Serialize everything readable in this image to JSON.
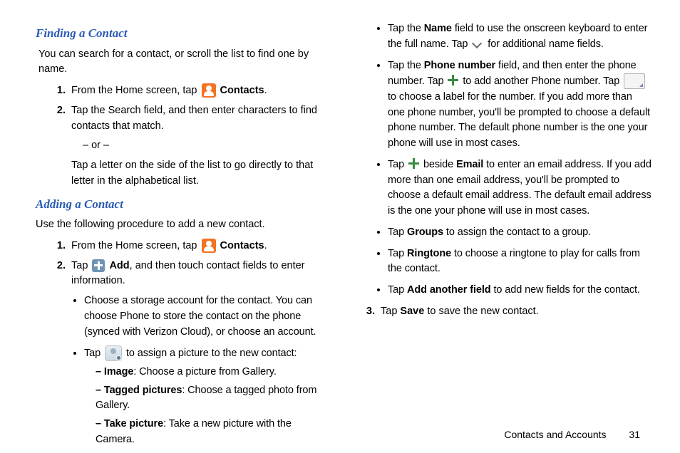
{
  "left": {
    "h1": "Finding a Contact",
    "intro1": "You can search for a contact, or scroll the list to find one by name.",
    "step1a_pre": "From the Home screen, tap ",
    "step1a_post": " Contacts",
    "step2a": "Tap the Search field, and then enter characters to find contacts that match.",
    "or": "– or –",
    "alt": "Tap a letter on the side of the list to go directly to that letter in the alphabetical list.",
    "h2": "Adding a Contact",
    "intro2": "Use the following procedure to add a new contact.",
    "step1b_pre": "From the Home screen, tap ",
    "step1b_post": " Contacts",
    "step2b_pre": "Tap ",
    "step2b_mid": " Add",
    "step2b_post": ", and then touch contact fields to enter information.",
    "b1": "Choose a storage account for the contact. You can choose Phone to store the contact on the phone (synced with Verizon Cloud), or choose an account.",
    "b2_pre": "Tap ",
    "b2_post": " to assign a picture to the new contact:",
    "d1_t": "Image",
    "d1_b": ": Choose a picture from Gallery.",
    "d2_t": "Tagged pictures",
    "d2_b": ": Choose a tagged photo from Gallery.",
    "d3_t": "Take picture",
    "d3_b": ": Take a new picture with the Camera."
  },
  "right": {
    "b1_a": "Tap the ",
    "b1_b": "Name",
    "b1_c": " field to use the onscreen keyboard to enter the full name. Tap ",
    "b1_d": " for additional name fields.",
    "b2_a": "Tap the ",
    "b2_b": "Phone number",
    "b2_c": " field, and then enter the phone number. Tap ",
    "b2_d": " to add another Phone number. Tap ",
    "b2_e": " to choose a label for the number. If you add more than one phone number, you'll be prompted to choose a default phone number. The default phone number is the one your phone will use in most cases.",
    "b3_a": "Tap ",
    "b3_b": " beside ",
    "b3_c": "Email",
    "b3_d": " to enter an email address. If you add more than one email address, you'll be prompted to choose a default email address. The default email address is the one your phone will use in most cases.",
    "b4_a": "Tap ",
    "b4_b": "Groups",
    "b4_c": " to assign the contact to a group.",
    "b5_a": "Tap ",
    "b5_b": "Ringtone",
    "b5_c": " to choose a ringtone to play for calls from the contact.",
    "b6_a": "Tap ",
    "b6_b": "Add another field",
    "b6_c": " to add new fields for the contact.",
    "s3_a": "Tap ",
    "s3_b": "Save",
    "s3_c": " to save the new contact."
  },
  "footer": {
    "section": "Contacts and Accounts",
    "page": "31"
  }
}
